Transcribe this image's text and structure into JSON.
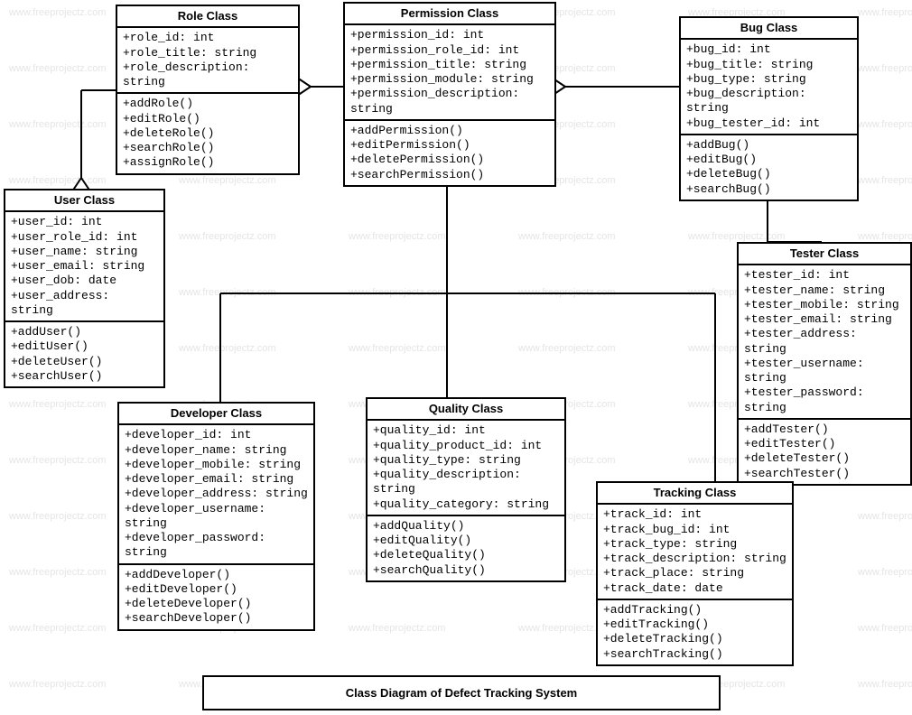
{
  "diagram_title": "Class Diagram of Defect Tracking System",
  "watermark_text": "www.freeprojectz.com",
  "classes": {
    "role": {
      "name": "Role Class",
      "attrs": [
        "+role_id: int",
        "+role_title: string",
        "+role_description: string"
      ],
      "methods": [
        "+addRole()",
        "+editRole()",
        "+deleteRole()",
        "+searchRole()",
        "+assignRole()"
      ]
    },
    "permission": {
      "name": "Permission Class",
      "attrs": [
        "+permission_id: int",
        "+permission_role_id: int",
        "+permission_title: string",
        "+permission_module: string",
        "+permission_description: string"
      ],
      "methods": [
        "+addPermission()",
        "+editPermission()",
        "+deletePermission()",
        "+searchPermission()"
      ]
    },
    "bug": {
      "name": "Bug Class",
      "attrs": [
        "+bug_id: int",
        "+bug_title: string",
        "+bug_type: string",
        "+bug_description: string",
        "+bug_tester_id: int"
      ],
      "methods": [
        "+addBug()",
        "+editBug()",
        "+deleteBug()",
        "+searchBug()"
      ]
    },
    "user": {
      "name": "User Class",
      "attrs": [
        "+user_id: int",
        "+user_role_id: int",
        "+user_name: string",
        "+user_email: string",
        "+user_dob: date",
        "+user_address: string"
      ],
      "methods": [
        "+addUser()",
        "+editUser()",
        "+deleteUser()",
        "+searchUser()"
      ]
    },
    "tester": {
      "name": "Tester Class",
      "attrs": [
        "+tester_id: int",
        "+tester_name: string",
        "+tester_mobile: string",
        "+tester_email: string",
        "+tester_address: string",
        "+tester_username: string",
        "+tester_password: string"
      ],
      "methods": [
        "+addTester()",
        "+editTester()",
        "+deleteTester()",
        "+searchTester()"
      ]
    },
    "developer": {
      "name": "Developer Class",
      "attrs": [
        "+developer_id: int",
        "+developer_name: string",
        "+developer_mobile: string",
        "+developer_email: string",
        "+developer_address: string",
        "+developer_username: string",
        "+developer_password: string"
      ],
      "methods": [
        "+addDeveloper()",
        "+editDeveloper()",
        "+deleteDeveloper()",
        "+searchDeveloper()"
      ]
    },
    "quality": {
      "name": "Quality Class",
      "attrs": [
        "+quality_id: int",
        "+quality_product_id: int",
        "+quality_type: string",
        "+quality_description: string",
        "+quality_category: string"
      ],
      "methods": [
        "+addQuality()",
        "+editQuality()",
        "+deleteQuality()",
        "+searchQuality()"
      ]
    },
    "tracking": {
      "name": "Tracking Class",
      "attrs": [
        "+track_id: int",
        "+track_bug_id: int",
        "+track_type: string",
        "+track_description: string",
        "+track_place: string",
        "+track_date: date"
      ],
      "methods": [
        "+addTracking()",
        "+editTracking()",
        "+deleteTracking()",
        "+searchTracking()"
      ]
    }
  }
}
